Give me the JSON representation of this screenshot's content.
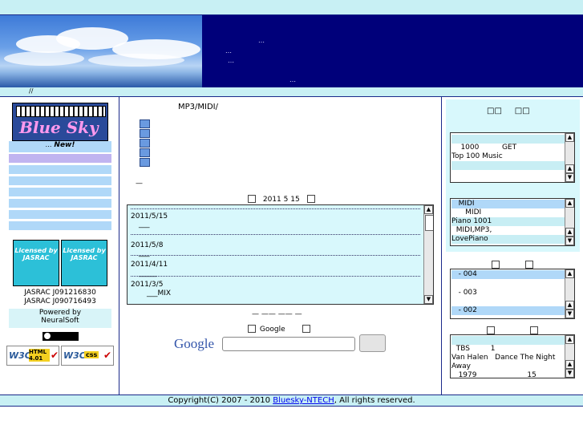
{
  "banner": {
    "line1": "…",
    "line2": "…",
    "line3": "…",
    "line4": "…"
  },
  "breadcrumb": "//",
  "left": {
    "logo_text": "Blue Sky",
    "new_label": "New!",
    "new_prefix": "…",
    "jasrac_badge": "Licensed by JASRAC",
    "jasrac1": "JASRAC  J091216830",
    "jasrac2": "JASRAC  J090716493",
    "powered_line1": "Powered by",
    "powered_line2": "NeuralSoft",
    "w3c_html": "HTML 4.01",
    "w3c_css": "css"
  },
  "center": {
    "heading": "MP3/MIDI/",
    "dash": "—",
    "date_heading": "2011 5 15",
    "news": [
      {
        "date": "2011/5/15",
        "text": "___"
      },
      {
        "date": "2011/5/8",
        "text": "___"
      },
      {
        "date": "2011/4/11",
        "text": "_____"
      },
      {
        "date": "2011/3/5",
        "text": "___MIX"
      }
    ],
    "links_dashes": "— —— —— —",
    "google_label": "Google",
    "google_logo": "Google",
    "search_value": "",
    "search_button": ""
  },
  "right": {
    "top_heading": "□□     □□",
    "box1": [
      {
        "text": "",
        "style": "lb"
      },
      {
        "text": "    1000          GET",
        "style": "plain"
      },
      {
        "text": "Top 100 Music",
        "style": "plain"
      },
      {
        "text": "",
        "style": "lb"
      }
    ],
    "box2": [
      {
        "text": "   MIDI",
        "style": "mb"
      },
      {
        "text": "      MIDI",
        "style": "plain"
      },
      {
        "text": "Piano 1001",
        "style": "lb"
      },
      {
        "text": "  MIDI,MP3,",
        "style": "plain"
      },
      {
        "text": "LovePiano",
        "style": "lb"
      }
    ],
    "box3": [
      {
        "text": "   - 004",
        "style": "mb"
      },
      {
        "text": "",
        "style": "plain"
      },
      {
        "text": "   - 003",
        "style": "plain"
      },
      {
        "text": "",
        "style": "plain"
      },
      {
        "text": "   - 002",
        "style": "mb"
      }
    ],
    "box4": [
      {
        "text": "",
        "style": "lb"
      },
      {
        "text": "  TBS         1",
        "style": "plain"
      },
      {
        "text": "Van Halen   Dance The Night",
        "style": "plain"
      },
      {
        "text": "Away",
        "style": "plain"
      },
      {
        "text": "   1979                      15",
        "style": "plain"
      }
    ]
  },
  "footer": {
    "prefix": "Copyright(C) 2007 - 2010 ",
    "link": "Bluesky-NTECH",
    "suffix": ", All rights reserved."
  },
  "colors": {
    "accent": "#00007a",
    "light": "#c8f0f4",
    "nav": "#b0d8f8"
  }
}
